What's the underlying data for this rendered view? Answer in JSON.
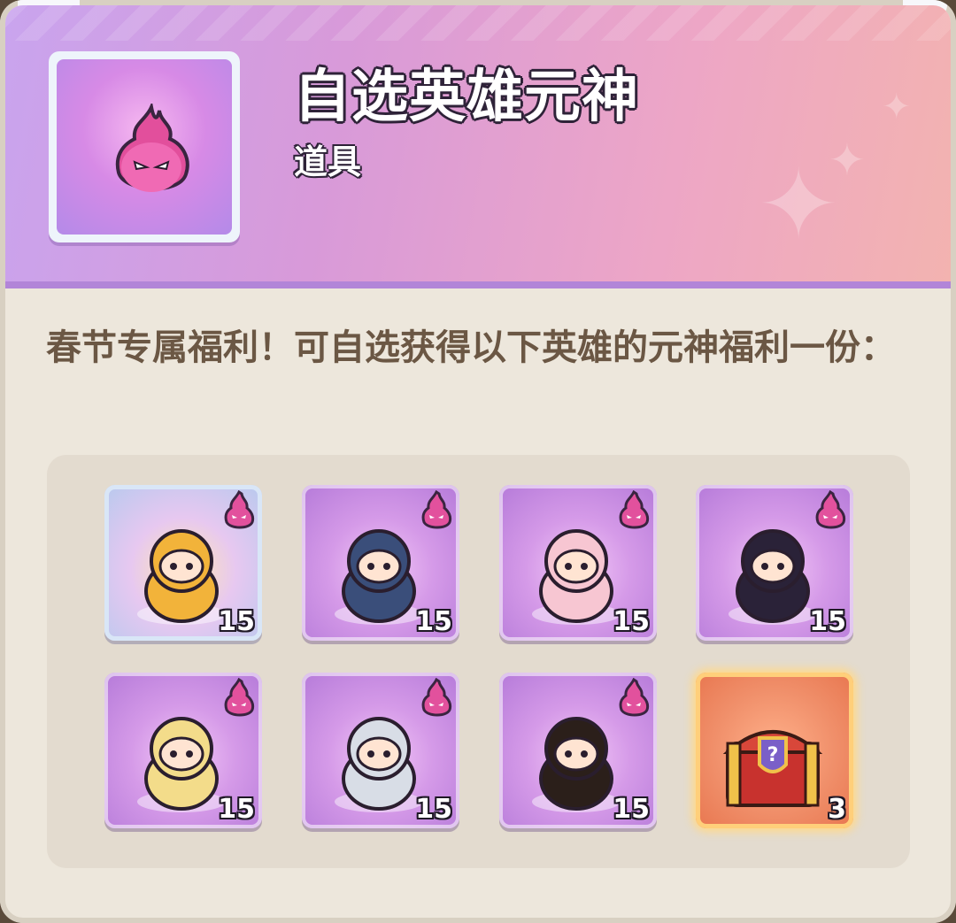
{
  "item": {
    "title": "自选英雄元神",
    "type": "道具",
    "icon": "pink-fire-spirit-icon"
  },
  "description": "春节专属福利！可自选获得以下英雄的元神福利一份：",
  "rewards": [
    {
      "icon": "monkey-king-hero-icon",
      "count": "15",
      "frame": "blue",
      "badge": "spirit-badge-icon"
    },
    {
      "icon": "dark-dragon-hero-icon",
      "count": "15",
      "frame": "purple",
      "badge": "spirit-badge-icon"
    },
    {
      "icon": "pink-fox-girl-hero-icon",
      "count": "15",
      "frame": "purple",
      "badge": "spirit-badge-icon"
    },
    {
      "icon": "shadow-cat-hero-icon",
      "count": "15",
      "frame": "purple",
      "badge": "spirit-badge-icon"
    },
    {
      "icon": "angel-hero-icon",
      "count": "15",
      "frame": "purple",
      "badge": "spirit-badge-icon"
    },
    {
      "icon": "silver-swordsman-hero-icon",
      "count": "15",
      "frame": "purple",
      "badge": "spirit-badge-icon"
    },
    {
      "icon": "ring-girl-hero-icon",
      "count": "15",
      "frame": "purple",
      "badge": "spirit-badge-icon"
    },
    {
      "icon": "mystery-chest-icon",
      "count": "3",
      "frame": "gold",
      "badge": ""
    }
  ]
}
